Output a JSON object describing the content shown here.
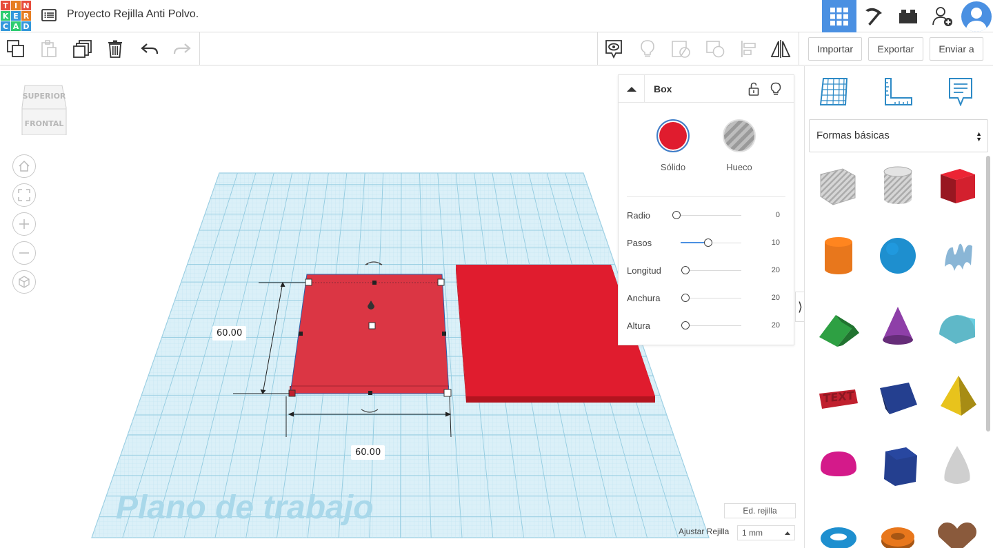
{
  "app": {
    "logo_letters": [
      "T",
      "I",
      "N",
      "K",
      "E",
      "R",
      "C",
      "A",
      "D"
    ],
    "logo_colors": [
      "#e74c3c",
      "#e67e22",
      "#e74c3c",
      "#2ecc71",
      "#3498db",
      "#e67e22",
      "#3498db",
      "#2ecc71",
      "#3498db"
    ],
    "project_title": "Proyecto Rejilla Anti Polvo.",
    "accent_color": "#4a90e2"
  },
  "header": {
    "tabs": [
      {
        "name": "3d-design-tab",
        "icon": "grid-apps-icon",
        "active": true
      },
      {
        "name": "codeblocks-tab",
        "icon": "pickaxe-icon",
        "active": false
      },
      {
        "name": "bricks-tab",
        "icon": "brick-icon",
        "active": false
      },
      {
        "name": "add-user-tab",
        "icon": "add-user-icon",
        "active": false
      }
    ],
    "avatar_icon": "user-avatar-icon"
  },
  "toolbar": {
    "left_tools": [
      "copy-icon",
      "paste-icon",
      "duplicate-icon",
      "delete-icon",
      "undo-icon",
      "redo-icon"
    ],
    "right_tools": [
      "view-notes-icon",
      "light-bulb-icon",
      "group-icon",
      "ungroup-icon",
      "align-icon",
      "mirror-icon"
    ],
    "import_label": "Importar",
    "export_label": "Exportar",
    "send_label": "Enviar a"
  },
  "viewcube": {
    "top_label": "SUPERIOR",
    "front_label": "FRONTAL"
  },
  "nav_controls": [
    "home-icon",
    "fit-view-icon",
    "zoom-in-icon",
    "zoom-out-icon",
    "perspective-icon"
  ],
  "workplane": {
    "label": "Plano de trabajo",
    "dim_width": "60.00",
    "dim_length": "60.00",
    "colors": {
      "grid": "#aedcee",
      "plane": "#d8eff8",
      "shape": "#e01c2e",
      "shape_selected": "#db3644"
    }
  },
  "inspector": {
    "title": "Box",
    "solid_label": "Sólido",
    "hole_label": "Hueco",
    "solid_color": "#e01c2e",
    "params": [
      {
        "label": "Radio",
        "value": "0",
        "fraction": 0.0
      },
      {
        "label": "Pasos",
        "value": "10",
        "fraction": 0.45
      },
      {
        "label": "Longitud",
        "value": "20",
        "fraction": 0.0
      },
      {
        "label": "Anchura",
        "value": "20",
        "fraction": 0.0
      },
      {
        "label": "Altura",
        "value": "20",
        "fraction": 0.0
      }
    ]
  },
  "grid_controls": {
    "edit_grid_label": "Ed. rejilla",
    "snap_label": "Ajustar Rejilla",
    "snap_value": "1 mm"
  },
  "right_panel": {
    "mode_icons": [
      "workplane-grid-icon",
      "ruler-icon",
      "notes-icon"
    ],
    "shape_category": "Formas básicas",
    "shapes": [
      {
        "name": "box-hole",
        "color": "#bdbdbd"
      },
      {
        "name": "cylinder-hole",
        "color": "#bdbdbd"
      },
      {
        "name": "box",
        "color": "#d3202e"
      },
      {
        "name": "cylinder",
        "color": "#e8771c"
      },
      {
        "name": "sphere",
        "color": "#1e8fcf"
      },
      {
        "name": "scribble",
        "color": "#8ab6d6"
      },
      {
        "name": "roof",
        "color": "#2ea043"
      },
      {
        "name": "cone",
        "color": "#8e3fa8"
      },
      {
        "name": "round-roof",
        "color": "#5fb8c8"
      },
      {
        "name": "text",
        "color": "#c0202e"
      },
      {
        "name": "wedge",
        "color": "#243f8f"
      },
      {
        "name": "pyramid",
        "color": "#e8c31c"
      },
      {
        "name": "half-sphere",
        "color": "#d41a8a"
      },
      {
        "name": "polygon",
        "color": "#243f8f"
      },
      {
        "name": "paraboloid",
        "color": "#cfcfcf"
      },
      {
        "name": "torus",
        "color": "#1e8fcf"
      },
      {
        "name": "tube",
        "color": "#e8771c"
      },
      {
        "name": "heart",
        "color": "#8a5a3c"
      }
    ]
  }
}
